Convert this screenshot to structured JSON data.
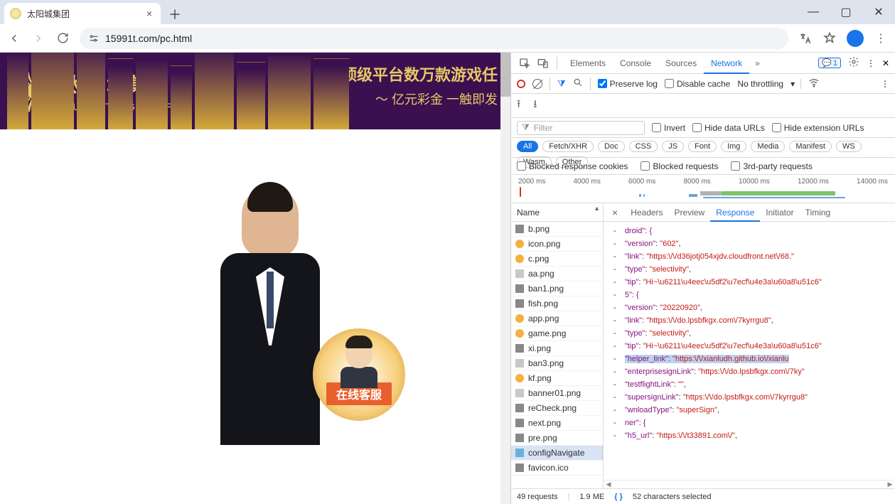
{
  "browser": {
    "tab_title": "太阳城集团",
    "url": "15991t.com/pc.html"
  },
  "page_content": {
    "logo_cn": "太陽城集團",
    "logo_en": "SUNCITY GROUP",
    "slogan_line1": "顶级平台数万款游戏任",
    "slogan_line2": "亿元彩金 一触即发",
    "badge_label": "在线客服"
  },
  "devtools": {
    "panels": [
      "Elements",
      "Console",
      "Sources",
      "Network"
    ],
    "active_panel": "Network",
    "issue_badge": "1",
    "net_toolbar": {
      "preserve_log": "Preserve log",
      "disable_cache": "Disable cache",
      "throttling": "No throttling"
    },
    "filter_placeholder": "Filter",
    "filter_opts": {
      "invert": "Invert",
      "hide_urls": "Hide data URLs",
      "hide_ext": "Hide extension URLs"
    },
    "types": [
      "All",
      "Fetch/XHR",
      "Doc",
      "CSS",
      "JS",
      "Font",
      "Img",
      "Media",
      "Manifest",
      "WS",
      "Wasm",
      "Other"
    ],
    "blocked_opts": {
      "blocked_cookies": "Blocked response cookies",
      "blocked_req": "Blocked requests",
      "third": "3rd-party requests"
    },
    "timeline_ticks": [
      "2000 ms",
      "4000 ms",
      "6000 ms",
      "8000 ms",
      "10000 ms",
      "12000 ms",
      "14000 ms"
    ],
    "name_header": "Name",
    "requests": [
      {
        "name": "b.png",
        "icon": "fimg"
      },
      {
        "name": "icon.png",
        "icon": "fics"
      },
      {
        "name": "c.png",
        "icon": "fics"
      },
      {
        "name": "aa.png",
        "icon": "fdoc"
      },
      {
        "name": "ban1.png",
        "icon": "fimg"
      },
      {
        "name": "fish.png",
        "icon": "fimg"
      },
      {
        "name": "app.png",
        "icon": "fics"
      },
      {
        "name": "game.png",
        "icon": "fics"
      },
      {
        "name": "xi.png",
        "icon": "fimg"
      },
      {
        "name": "ban3.png",
        "icon": "fdoc"
      },
      {
        "name": "kf.png",
        "icon": "fics"
      },
      {
        "name": "banner01.png",
        "icon": "fdoc"
      },
      {
        "name": "reCheck.png",
        "icon": "fimg"
      },
      {
        "name": "next.png",
        "icon": "fimg"
      },
      {
        "name": "pre.png",
        "icon": "fimg"
      },
      {
        "name": "configNavigate",
        "icon": "fjs",
        "selected": true
      },
      {
        "name": "favicon.ico",
        "icon": "fimg"
      }
    ],
    "detail_tabs": [
      "Headers",
      "Preview",
      "Response",
      "Initiator",
      "Timing"
    ],
    "active_detail_tab": "Response",
    "response_lines": [
      {
        "t": "obj",
        "text": "droid\": {"
      },
      {
        "t": "kv",
        "k": "version",
        "v": "602",
        "c": ","
      },
      {
        "t": "kv",
        "k": "link",
        "v": "https:\\/\\/d36jotj054xjdv.cloudfront.net\\/68.",
        "c": ""
      },
      {
        "t": "kv",
        "k": "type",
        "v": "selectivity",
        "c": ","
      },
      {
        "t": "kv",
        "k": "tip",
        "v": "Hi~\\u6211\\u4eec\\u5df2\\u7ecf\\u4e3a\\u60a8\\u51c6",
        "c": ""
      },
      {
        "t": "obj",
        "text": "5\": {"
      },
      {
        "t": "kv",
        "k": "version",
        "v": "20220920",
        "c": ","
      },
      {
        "t": "kv",
        "k": "link",
        "v": "https:\\/\\/do.lpsbfkgx.com\\/7kyrrgu8",
        "c": ","
      },
      {
        "t": "kv",
        "k": "type",
        "v": "selectivity",
        "c": ","
      },
      {
        "t": "kv",
        "k": "tip",
        "v": "Hi~\\u6211\\u4eec\\u5df2\\u7ecf\\u4e3a\\u60a8\\u51c6",
        "c": ""
      },
      {
        "t": "kvhl",
        "k": "helper_link",
        "v": "https:\\/\\/xianludh.github.io\\/xianlu",
        "c": ""
      },
      {
        "t": "kv",
        "k": "enterprisesignLink",
        "v": "https:\\/\\/do.lpsbfkgx.com\\/7ky",
        "c": ""
      },
      {
        "t": "kv",
        "k": "testflightLink",
        "v": "",
        "c": ","
      },
      {
        "t": "kv",
        "k": "supersignLink",
        "v": "https:\\/\\/do.lpsbfkgx.com\\/7kyrrgu8",
        "c": ""
      },
      {
        "t": "kv",
        "k": "wnloadType",
        "v": "superSign",
        "c": ","
      },
      {
        "t": "obj",
        "text": "ner\": {"
      },
      {
        "t": "kv",
        "k": "h5_url",
        "v": "https:\\/\\/t33891.com\\/",
        "c": ","
      }
    ],
    "statusbar": {
      "requests": "49 requests",
      "size": "1.9 ME",
      "selected": "52 characters selected"
    }
  }
}
